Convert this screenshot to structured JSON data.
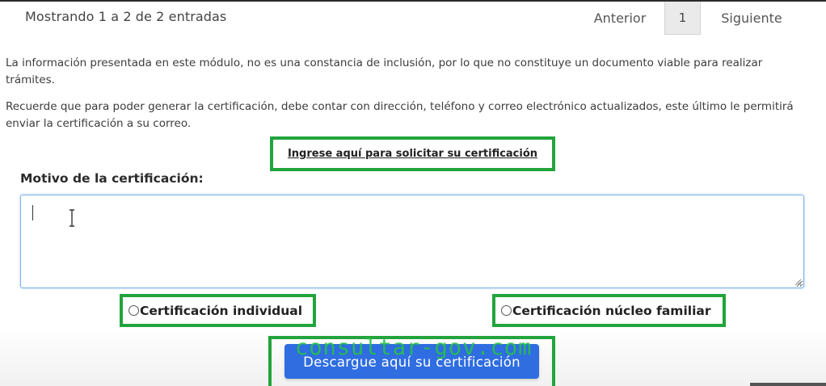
{
  "table_footer": {
    "entries_info": "Mostrando 1 a 2 de 2 entradas",
    "pagination": {
      "previous_label": "Anterior",
      "current_page": "1",
      "next_label": "Siguiente"
    }
  },
  "notices": {
    "info_1": "La información presentada en este módulo, no es una constancia de inclusión, por lo que no constituye un documento viable para realizar trámites.",
    "info_2": "Recuerde que para poder generar la certificación, debe contar con dirección, teléfono y correo electrónico actualizados, este último le permitirá enviar la certificación a su correo."
  },
  "request_link": "Ingrese aquí para solicitar su certificación",
  "form": {
    "motivo_label": "Motivo de la certificación:",
    "motivo_value": "",
    "options": [
      {
        "label": "Certificación individual",
        "selected": false
      },
      {
        "label": "Certificación núcleo familiar",
        "selected": false
      }
    ],
    "download_button": "Descargue aquí su certificación"
  },
  "watermark": "consultar-gov.com",
  "colors": {
    "highlight_green": "#22a43c",
    "button_blue": "#2f6de1",
    "textarea_focus": "#7fb2e8"
  }
}
